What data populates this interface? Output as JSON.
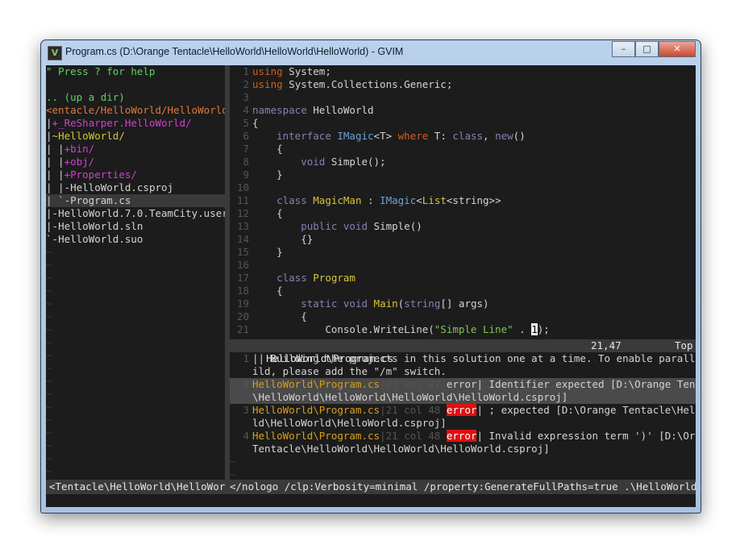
{
  "window": {
    "title": "Program.cs (D:\\Orange Tentacle\\HelloWorld\\HelloWorld\\HelloWorld) - GVIM",
    "app_icon_text": "V",
    "buttons": {
      "minimize": "–",
      "maximize": "□",
      "close": "✕"
    }
  },
  "tree": {
    "help": "\" Press ? for help",
    "updir": ".. (up a dir)",
    "root": "<entacle/HelloWorld/HelloWorld/",
    "items": [
      {
        "prefix": "|",
        "marker": "+",
        "name": "_ReSharper.HelloWorld/"
      },
      {
        "prefix": "|",
        "marker": "~",
        "name": "HelloWorld/"
      },
      {
        "prefix": "| |",
        "marker": "+",
        "name": "bin/"
      },
      {
        "prefix": "| |",
        "marker": "+",
        "name": "obj/"
      },
      {
        "prefix": "| |",
        "marker": "+",
        "name": "Properties/"
      },
      {
        "prefix": "| |",
        "marker": "-",
        "name": "HelloWorld.csproj"
      },
      {
        "prefix": "| `",
        "marker": "-",
        "name": "Program.cs"
      },
      {
        "prefix": "|",
        "marker": "-",
        "name": "HelloWorld.7.0.TeamCity.user"
      },
      {
        "prefix": "|",
        "marker": "-",
        "name": "HelloWorld.sln"
      },
      {
        "prefix": "`",
        "marker": "-",
        "name": "HelloWorld.suo"
      }
    ]
  },
  "code": {
    "numbers": [
      "1",
      "2",
      "3",
      "4",
      "5",
      "6",
      "7",
      "8",
      "9",
      "10",
      "11",
      "12",
      "13",
      "14",
      "15",
      "16",
      "17",
      "18",
      "19",
      "20",
      "21"
    ],
    "l1a": "using",
    "l1b": " System;",
    "l2a": "using",
    "l2b": " System.Collections.Generic;",
    "l4a": "namespace",
    "l4b": " HelloWorld",
    "brace_open": "{",
    "brace_close": "}",
    "l6a": "interface",
    "l6b": "IMagic",
    "l6c": "<T> ",
    "l6d": "where",
    "l6e": " T: ",
    "l6f": "class",
    "l6g": ", ",
    "l6h": "new",
    "l6i": "()",
    "l8a": "void",
    "l8b": " Simple();",
    "l11a": "class",
    "l11b": "MagicMan",
    "l11c": " : ",
    "l11d": "IMagic",
    "l11e": "<",
    "l11f": "List",
    "l11g": "<string>>",
    "l13a": "public",
    "l13b": "void",
    "l13c": " Simple()",
    "l14": "{}",
    "l17a": "class",
    "l17b": "Program",
    "l19a": "static",
    "l19b": "void",
    "l19c": "Main",
    "l19d": "(",
    "l19e": "string",
    "l19f": "[] args)",
    "l21a": "Console.WriteLine(",
    "l21b": "\"Simple Line\"",
    "l21c": " . ",
    "l21d": "1",
    "l21e": ");"
  },
  "status": {
    "file": "HelloWorld\\Program.cs",
    "position": "21,47",
    "scroll": "Top"
  },
  "quickfix": {
    "numbers": [
      "1",
      "2",
      "3",
      "4"
    ],
    "q1a": "|| Building the projects in this solution one at a time. To enable parallel bu",
    "q1b": "ild, please add the \"/m\" switch.",
    "q2file": "HelloWorld\\Program.cs",
    "q2col": "|21 col 47",
    "q2err": " error",
    "q2msg": "| Identifier expected [D:\\Orange Tentacle",
    "q2cont": "\\HelloWorld\\HelloWorld\\HelloWorld\\HelloWorld.csproj]",
    "q3file": "HelloWorld\\Program.cs",
    "q3col": "|21 col 48 ",
    "q3err": "error",
    "q3msg": "| ; expected [D:\\Orange Tentacle\\HelloWor",
    "q3cont": "ld\\HelloWorld\\HelloWorld.csproj]",
    "q4file": "HelloWorld\\Program.cs",
    "q4col": "|21 col 48 ",
    "q4err": "error",
    "q4msg": "| Invalid expression term ')' [D:\\Orange",
    "q4cont": "Tentacle\\HelloWorld\\HelloWorld\\HelloWorld.csproj]"
  },
  "bottom": {
    "left": "<Tentacle\\HelloWorld\\HelloWorld",
    "right": "</nologo /clp:Verbosity=minimal /property:GenerateFullPaths=true .\\HelloWorld.sln"
  },
  "empty_marker": "~",
  "colors": {
    "background": "#1c1c1c",
    "keyword": "#d35f1a",
    "type": "#6fa0d8",
    "string": "#7ec850",
    "error": "#e01010",
    "file": "#d7a01a"
  }
}
